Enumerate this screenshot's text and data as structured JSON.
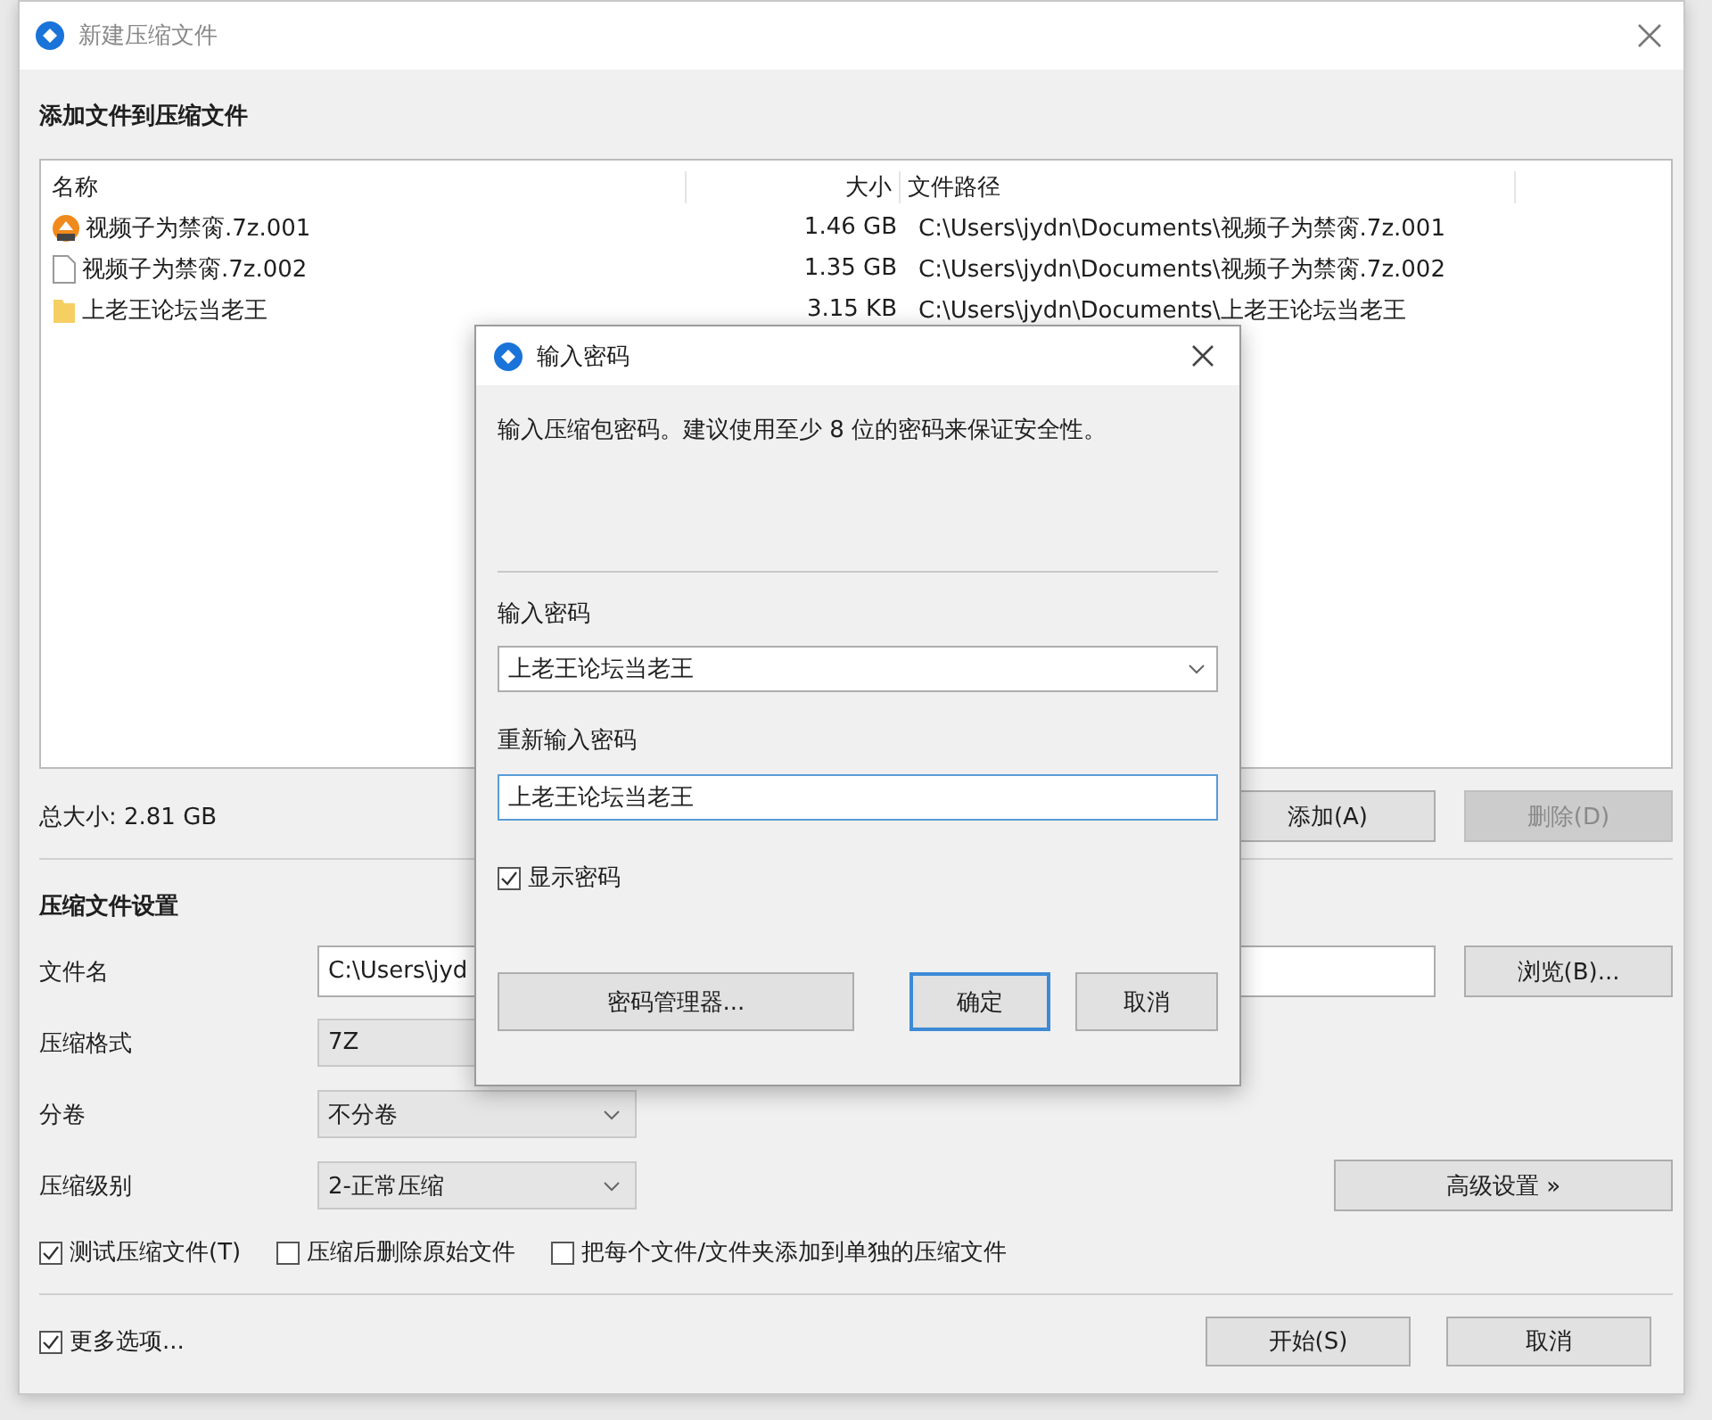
{
  "main_window": {
    "title": "新建压缩文件",
    "files_section": {
      "heading": "添加文件到压缩文件",
      "columns": [
        "名称",
        "大小",
        "文件路径"
      ],
      "rows": [
        {
          "kind": "archive",
          "name": "视频子为禁脔.7z.001",
          "size": "1.46 GB",
          "path": "C:\\Users\\jydn\\Documents\\视频子为禁脔.7z.001"
        },
        {
          "kind": "file",
          "name": "视频子为禁脔.7z.002",
          "size": "1.35 GB",
          "path": "C:\\Users\\jydn\\Documents\\视频子为禁脔.7z.002"
        },
        {
          "kind": "folder",
          "name": "上老王论坛当老王",
          "size": "3.15 KB",
          "path": "C:\\Users\\jydn\\Documents\\上老王论坛当老王"
        }
      ]
    },
    "total_size": "总大小: 2.81 GB",
    "add_button": {
      "label": "添加(A)",
      "disabled": false
    },
    "delete_button": {
      "label": "删除(D)",
      "disabled": true
    },
    "settings": {
      "heading": "压缩文件设置",
      "filename": {
        "label": "文件名",
        "value": "C:\\Users\\jyd"
      },
      "browse_button": "浏览(B)...",
      "format": {
        "label": "压缩格式",
        "value": "7Z"
      },
      "volume": {
        "label": "分卷",
        "value": "不分卷"
      },
      "level": {
        "label": "压缩级别",
        "value": "2-正常压缩"
      },
      "advanced_button": "高级设置 »",
      "options": [
        {
          "label": "测试压缩文件(T)",
          "checked": true
        },
        {
          "label": "压缩后删除原始文件",
          "checked": false
        },
        {
          "label": "把每个文件/文件夹添加到单独的压缩文件",
          "checked": false
        }
      ]
    },
    "more_options": {
      "label": "更多选项...",
      "checked": true
    },
    "start_button": "开始(S)",
    "cancel_button": "取消"
  },
  "password_dialog": {
    "title": "输入密码",
    "message": "输入压缩包密码。建议使用至少 8 位的密码来保证安全性。",
    "password_label": "输入密码",
    "password_value": "上老王论坛当老王",
    "confirm_label": "重新输入密码",
    "confirm_value": "上老王论坛当老王",
    "show_password": {
      "label": "显示密码",
      "checked": true
    },
    "manager_button": "密码管理器...",
    "ok_button": "确定",
    "cancel_button": "取消"
  }
}
